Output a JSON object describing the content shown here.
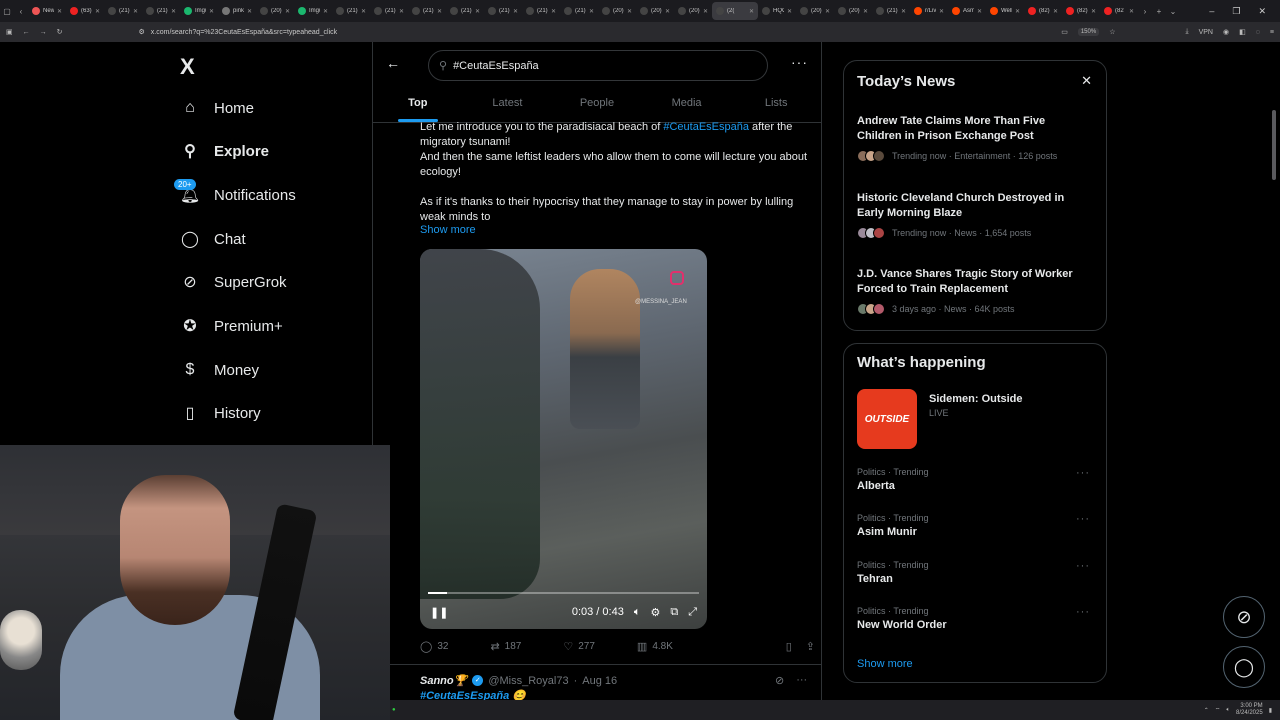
{
  "browser": {
    "tabs": [
      {
        "label": "New T",
        "color": "#e55"
      },
      {
        "label": "(63) Y",
        "color": "#e22"
      },
      {
        "label": "(21) H",
        "color": "#444"
      },
      {
        "label": "(21) H",
        "color": "#444"
      },
      {
        "label": "Imgu",
        "color": "#1bb76e"
      },
      {
        "label": "pinke",
        "color": "#777"
      },
      {
        "label": "(20) Z",
        "color": "#444"
      },
      {
        "label": "Imgu",
        "color": "#1bb76e"
      },
      {
        "label": "(21) P",
        "color": "#444"
      },
      {
        "label": "(21) E",
        "color": "#444"
      },
      {
        "label": "(21) y",
        "color": "#444"
      },
      {
        "label": "(21) D",
        "color": "#444"
      },
      {
        "label": "(21) G",
        "color": "#444"
      },
      {
        "label": "(21) C",
        "color": "#444"
      },
      {
        "label": "(21) D",
        "color": "#444"
      },
      {
        "label": "(20) H",
        "color": "#444"
      },
      {
        "label": "(20) H",
        "color": "#444"
      },
      {
        "label": "(20) B",
        "color": "#444"
      },
      {
        "label": "(2(",
        "color": "#444",
        "active": true
      },
      {
        "label": "HQG",
        "color": "#444"
      },
      {
        "label": "(20) G",
        "color": "#444"
      },
      {
        "label": "(20) E",
        "color": "#444"
      },
      {
        "label": "(21) y",
        "color": "#444"
      },
      {
        "label": "r/Live",
        "color": "#ff4500"
      },
      {
        "label": "Asmo",
        "color": "#ff4500"
      },
      {
        "label": "Well",
        "color": "#ff4500"
      },
      {
        "label": "(82) Y",
        "color": "#e22"
      },
      {
        "label": "(82) Y",
        "color": "#e22"
      },
      {
        "label": "(82",
        "color": "#e22"
      }
    ],
    "url": "x.com/search?q=%23CeutaEsEspaña&src=typeahead_click",
    "zoom": "150%",
    "vpn": "VPN"
  },
  "sidebar": {
    "logo": "X",
    "items": [
      {
        "label": "Home",
        "icon": "home-icon",
        "glyph": "⌂"
      },
      {
        "label": "Explore",
        "icon": "search-icon",
        "glyph": "⚲",
        "bold": true
      },
      {
        "label": "Notifications",
        "icon": "bell-icon",
        "glyph": "🔔︎",
        "badge": "20+"
      },
      {
        "label": "Chat",
        "icon": "chat-icon",
        "glyph": "◯"
      },
      {
        "label": "SuperGrok",
        "icon": "grok-icon",
        "glyph": "⊘"
      },
      {
        "label": "Premium+",
        "icon": "premium-icon",
        "glyph": "✪"
      },
      {
        "label": "Money",
        "icon": "money-icon",
        "glyph": "$"
      },
      {
        "label": "History",
        "icon": "bookmark-icon",
        "glyph": "▯"
      }
    ]
  },
  "search": {
    "query": "#CeutaEsEspaña",
    "tabs": [
      "Top",
      "Latest",
      "People",
      "Media",
      "Lists"
    ],
    "active_tab": "Top"
  },
  "tweet": {
    "line1_pre": "Let me introduce you to the paradisiacal beach of ",
    "line1_tag": "#CeutaEsEspaña",
    "line1_post": " after the migratory tsunami!",
    "line2": "And then the same leftist leaders who allow them to come will lecture you about ecology!",
    "line3": "As if it's thanks to their hypocrisy that they manage to stay in power by lulling weak minds to",
    "show_more": "Show more",
    "video": {
      "watermark": "@MESSINA_JEAN",
      "time": "0:03 / 0:43",
      "progress": 0.07
    },
    "stats": {
      "replies": "32",
      "reposts": "187",
      "likes": "277",
      "views": "4.8K"
    }
  },
  "tweet2": {
    "name": "Sanno🏆",
    "handle": "@Miss_Royal73",
    "date": "Aug 16",
    "tag": "#CeutaEsEspaña 😊"
  },
  "todays_news": {
    "title": "Today’s News",
    "items": [
      {
        "headline": "Andrew Tate Claims More Than Five Children in Prison Exchange Post",
        "meta": "Trending now · Entertainment · 126 posts"
      },
      {
        "headline": "Historic Cleveland Church Destroyed in Early Morning Blaze",
        "meta": "Trending now · News · 1,654 posts"
      },
      {
        "headline": "J.D. Vance Shares Tragic Story of Worker Forced to Train Replacement",
        "meta": "3 days ago · News · 64K posts"
      }
    ]
  },
  "whats_happening": {
    "title": "What’s happening",
    "live": {
      "thumb": "OUTSIDE",
      "title": "Sidemen: Outside",
      "status": "LIVE"
    },
    "trends": [
      {
        "context": "Politics · Trending",
        "name": "Alberta"
      },
      {
        "context": "Politics · Trending",
        "name": "Asim Munir"
      },
      {
        "context": "Politics · Trending",
        "name": "Tehran"
      },
      {
        "context": "Politics · Trending",
        "name": "New World Order"
      }
    ],
    "show_more": "Show more"
  },
  "taskbar": {
    "time": "3:00 PM",
    "date": "8/24/2025"
  },
  "colors": {
    "accent": "#1d9bf0",
    "background": "#000000",
    "border": "#2f3336",
    "muted": "#71767b"
  }
}
